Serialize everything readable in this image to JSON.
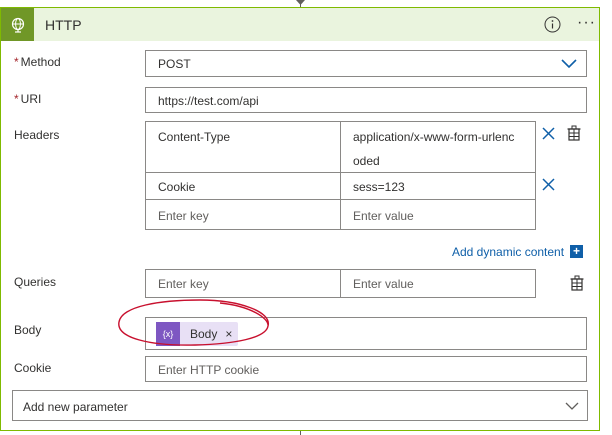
{
  "card": {
    "title": "HTTP",
    "info_icon": "info-icon",
    "more_glyph": "···"
  },
  "colors": {
    "accent_green": "#709727",
    "header_bg": "#eaf4de",
    "border_green": "#7fba00",
    "link_blue": "#0f5fa8",
    "token_purple": "#7e57c2",
    "annotation_red": "#c8102e"
  },
  "method": {
    "required_mark": "*",
    "label": "Method",
    "value": "POST"
  },
  "uri": {
    "required_mark": "*",
    "label": "URI",
    "value": "https://test.com/api"
  },
  "headers": {
    "label": "Headers",
    "rows": [
      {
        "key": "Content-Type",
        "value_line1": "application/x-www-form-urlenc",
        "value_line2": "oded"
      },
      {
        "key": "Cookie",
        "value_line1": "sess=123",
        "value_line2": ""
      }
    ],
    "key_placeholder": "Enter key",
    "value_placeholder": "Enter value",
    "add_dynamic_content": "Add dynamic content",
    "add_plus": "+"
  },
  "queries": {
    "label": "Queries",
    "key_placeholder": "Enter key",
    "value_placeholder": "Enter value"
  },
  "body": {
    "label": "Body",
    "token_icon": "{x}",
    "token_label": "Body",
    "token_remove": "×"
  },
  "cookie": {
    "label": "Cookie",
    "placeholder": "Enter HTTP cookie"
  },
  "add_parameter": {
    "label": "Add new parameter"
  }
}
